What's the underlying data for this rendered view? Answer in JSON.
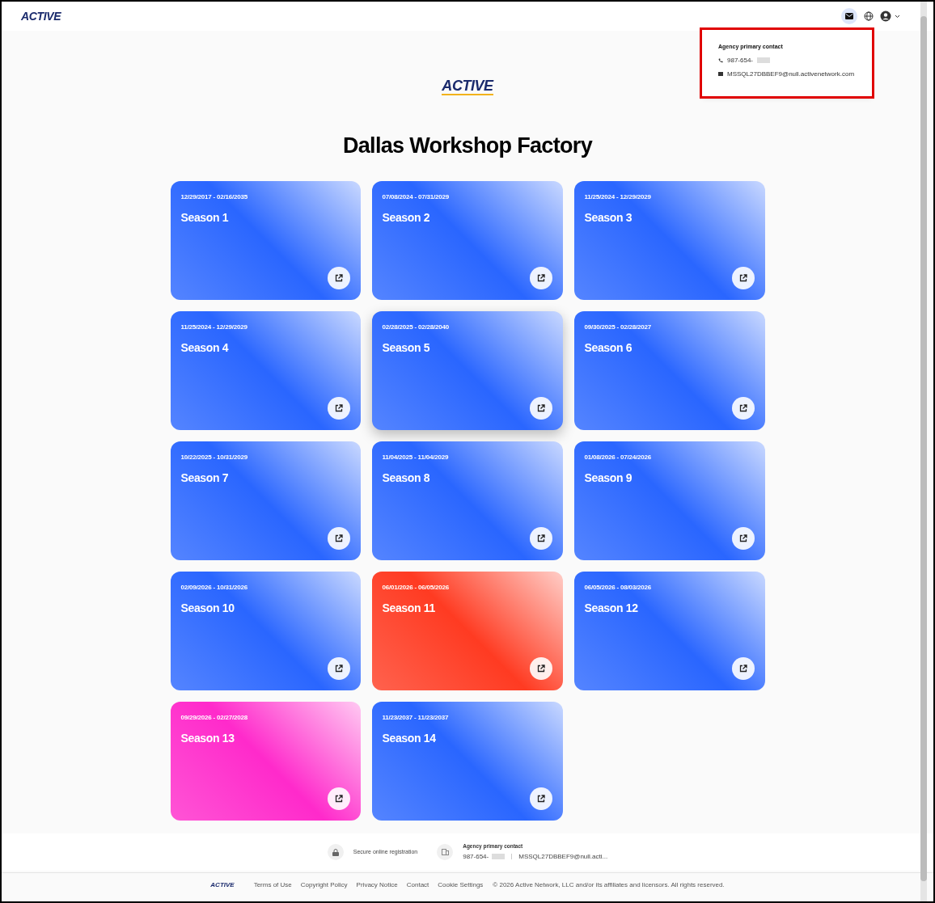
{
  "header": {
    "logo": "ACTIVE"
  },
  "contact_popover": {
    "title": "Agency primary contact",
    "phone": "987-654-",
    "email": "MSSQL27DBBEF9@null.activenetwork.com",
    "highlighted": true
  },
  "page": {
    "logo": "ACTIVE",
    "title": "Dallas Workshop Factory"
  },
  "seasons": [
    {
      "dates": "12/29/2017 - 02/16/2035",
      "name": "Season 1",
      "color": "#2a66ff",
      "hovered": false
    },
    {
      "dates": "07/08/2024 - 07/31/2029",
      "name": "Season 2",
      "color": "#2a66ff",
      "hovered": false
    },
    {
      "dates": "11/25/2024 - 12/29/2029",
      "name": "Season 3",
      "color": "#2a66ff",
      "hovered": false
    },
    {
      "dates": "11/25/2024 - 12/29/2029",
      "name": "Season 4",
      "color": "#2a66ff",
      "hovered": false
    },
    {
      "dates": "02/28/2025 - 02/28/2040",
      "name": "Season 5",
      "color": "#2a66ff",
      "hovered": true
    },
    {
      "dates": "09/30/2025 - 02/28/2027",
      "name": "Season 6",
      "color": "#2a66ff",
      "hovered": false
    },
    {
      "dates": "10/22/2025 - 10/31/2029",
      "name": "Season 7",
      "color": "#2a66ff",
      "hovered": false
    },
    {
      "dates": "11/04/2025 - 11/04/2029",
      "name": "Season 8",
      "color": "#2a66ff",
      "hovered": false
    },
    {
      "dates": "01/08/2026 - 07/24/2026",
      "name": "Season 9",
      "color": "#2a66ff",
      "hovered": false
    },
    {
      "dates": "02/09/2026 - 10/31/2026",
      "name": "Season 10",
      "color": "#2a66ff",
      "hovered": false
    },
    {
      "dates": "06/01/2026 - 06/05/2026",
      "name": "Season 11",
      "color": "#ff3b22",
      "hovered": false
    },
    {
      "dates": "06/05/2026 - 08/03/2026",
      "name": "Season 12",
      "color": "#2a66ff",
      "hovered": false
    },
    {
      "dates": "09/29/2026 - 02/27/2028",
      "name": "Season 13",
      "color": "#ff2acb",
      "hovered": false
    },
    {
      "dates": "11/23/2037 - 11/23/2037",
      "name": "Season 14",
      "color": "#2a66ff",
      "hovered": false
    }
  ],
  "info_bar": {
    "secure": "Secure online registration",
    "contact_title": "Agency primary contact",
    "phone": "987-654-",
    "email": "MSSQL27DBBEF9@null.acti..."
  },
  "footer": {
    "logo": "ACTIVE",
    "links": [
      "Terms of Use",
      "Copyright Policy",
      "Privacy Notice",
      "Contact",
      "Cookie Settings"
    ],
    "copyright": "© 2026 Active Network, LLC and/or its affiliates and licensors. All rights reserved."
  }
}
